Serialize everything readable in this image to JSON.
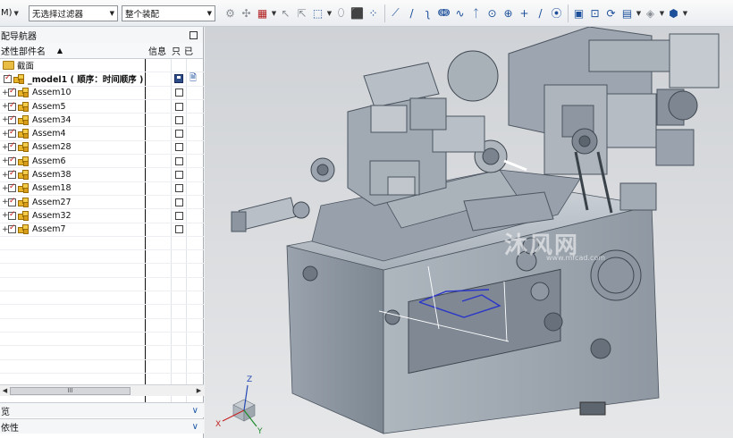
{
  "toolbar": {
    "menu_label": "M)",
    "filter_select": "无选择过滤器",
    "scope_select": "整个装配"
  },
  "navigator": {
    "title": "配导航器",
    "columns": {
      "name": "述性部件名",
      "info": "信息",
      "only": "只",
      "ref": "已"
    },
    "section_row": "截面",
    "model_row": "_model1 ( 顺序：时间顺序 )",
    "items": [
      "Assem10",
      "Assem5",
      "Assem34",
      "Assem4",
      "Assem28",
      "Assem6",
      "Assem38",
      "Assem18",
      "Assem27",
      "Assem32",
      "Assem7"
    ],
    "hscroll_thumb": "III",
    "preview_section": "览",
    "dependency_section": "依性"
  },
  "viewport": {
    "watermark": "沐风网",
    "watermark_url": "www.mfcad.com",
    "axes": {
      "x": "X",
      "y": "Y",
      "z": "Z"
    }
  },
  "colors": {
    "machine_body": "#8e9aa6",
    "viewport_bg": "#d6d8db",
    "selection_blue": "#2a36c8",
    "checkbox_red": "#c51b1b"
  }
}
